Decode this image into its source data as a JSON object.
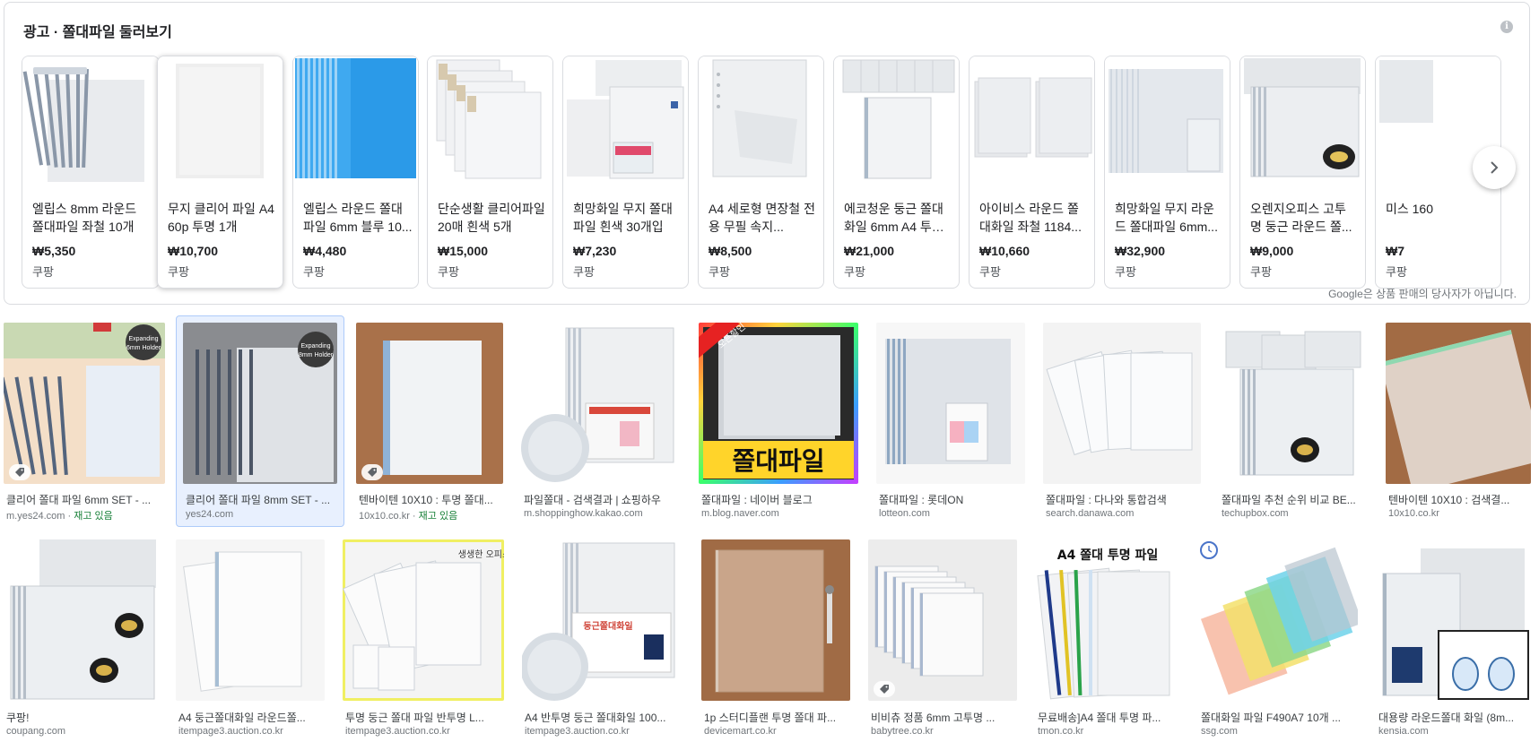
{
  "ad": {
    "title": "광고 · 쫄대파일 둘러보기",
    "info_glyph": "i",
    "disclaimer": "Google은 상품 판매의 당사자가 아닙니다.",
    "products": [
      {
        "name": "엘립스 8mm 라운드 쫄대파일 좌철 10개",
        "price": "₩5,350",
        "seller": "쿠팡"
      },
      {
        "name": "무지 클리어 파일 A4 60p 투명 1개",
        "price": "₩10,700",
        "seller": "쿠팡"
      },
      {
        "name": "엘립스 라운드 쫄대 파일 6mm 블루 10...",
        "price": "₩4,480",
        "seller": "쿠팡"
      },
      {
        "name": "단순생활 클리어파일 20매 흰색 5개",
        "price": "₩15,000",
        "seller": "쿠팡"
      },
      {
        "name": "희망화일 무지 쫄대 파일 흰색 30개입",
        "price": "₩7,230",
        "seller": "쿠팡"
      },
      {
        "name": "A4 세로형 면장철 전용 무필 속지...",
        "price": "₩8,500",
        "seller": "쿠팡"
      },
      {
        "name": "에코청운 둥근 쫄대 화일 6mm A4 투명...",
        "price": "₩21,000",
        "seller": "쿠팡"
      },
      {
        "name": "아이비스 라운드 쫄 대화일 좌철 1184...",
        "price": "₩10,660",
        "seller": "쿠팡"
      },
      {
        "name": "희망화일 무지 라운 드 쫄대파일 6mm...",
        "price": "₩32,900",
        "seller": "쿠팡"
      },
      {
        "name": "오렌지오피스 고투 명 둥근 라운드 쫄...",
        "price": "₩9,000",
        "seller": "쿠팡"
      },
      {
        "name": "미스 160",
        "price": "₩7",
        "seller": "쿠팡"
      }
    ]
  },
  "row1": [
    {
      "caption": "클리어 쫄대 파일 6mm SET - ...",
      "source": "m.yes24.com",
      "stock": "재고 있음",
      "overlay": "Expanding 6mm Holder"
    },
    {
      "caption": "클리어 쫄대 파일 8mm SET - ...",
      "source": "yes24.com",
      "overlay": "Expanding 8mm Holder"
    },
    {
      "caption": "텐바이텐 10X10 : 투명 쫄대...",
      "source": "10x10.co.kr",
      "stock": "재고 있음"
    },
    {
      "caption": "파일쫄대 - 검색결과 | 쇼핑하우",
      "source": "m.shoppinghow.kakao.com"
    },
    {
      "caption": "쫄대파일 : 네이버 블로그",
      "source": "m.blog.naver.com",
      "overlay": "쫄대파일",
      "badge": "오픈할인"
    },
    {
      "caption": "쫄대파일 : 롯데ON",
      "source": "lotteon.com"
    },
    {
      "caption": "쫄대파일 : 다나와 통합검색",
      "source": "search.danawa.com"
    },
    {
      "caption": "쫄대파일 추천 순위 비교 BE...",
      "source": "techupbox.com"
    },
    {
      "caption": "텐바이텐 10X10 : 검색결...",
      "source": "10x10.co.kr"
    }
  ],
  "row2": [
    {
      "caption": "쿠팡!",
      "source": "coupang.com"
    },
    {
      "caption": "A4 둥근쫄대화일 라운드쫄...",
      "source": "itempage3.auction.co.kr"
    },
    {
      "caption": "투명 둥근 쫄대 파일 반투명 L...",
      "source": "itempage3.auction.co.kr",
      "overlay": "생생한 오피스"
    },
    {
      "caption": "A4 반투명 둥근 쫄대화일 100...",
      "source": "itempage3.auction.co.kr",
      "overlay": "둥근쫄대화일"
    },
    {
      "caption": "1p 스터디플랜 투명 쫄대 파...",
      "source": "devicemart.co.kr"
    },
    {
      "caption": "비비츄 정품 6mm 고투명 ...",
      "source": "babytree.co.kr"
    },
    {
      "caption": "무료배송]A4 쫄대 투명 파...",
      "source": "tmon.co.kr",
      "overlay": "A4 쫄대 투명 파일"
    },
    {
      "caption": "쫄대화일 파일 F490A7 10개 ...",
      "source": "ssg.com"
    },
    {
      "caption": "대용량 라운드쫄대 화일 (8m...",
      "source": "kensia.com"
    }
  ],
  "colors": {
    "accent_blue": "#1a73e8",
    "stock_green": "#188038",
    "selected_bg": "#e8f0fe"
  }
}
